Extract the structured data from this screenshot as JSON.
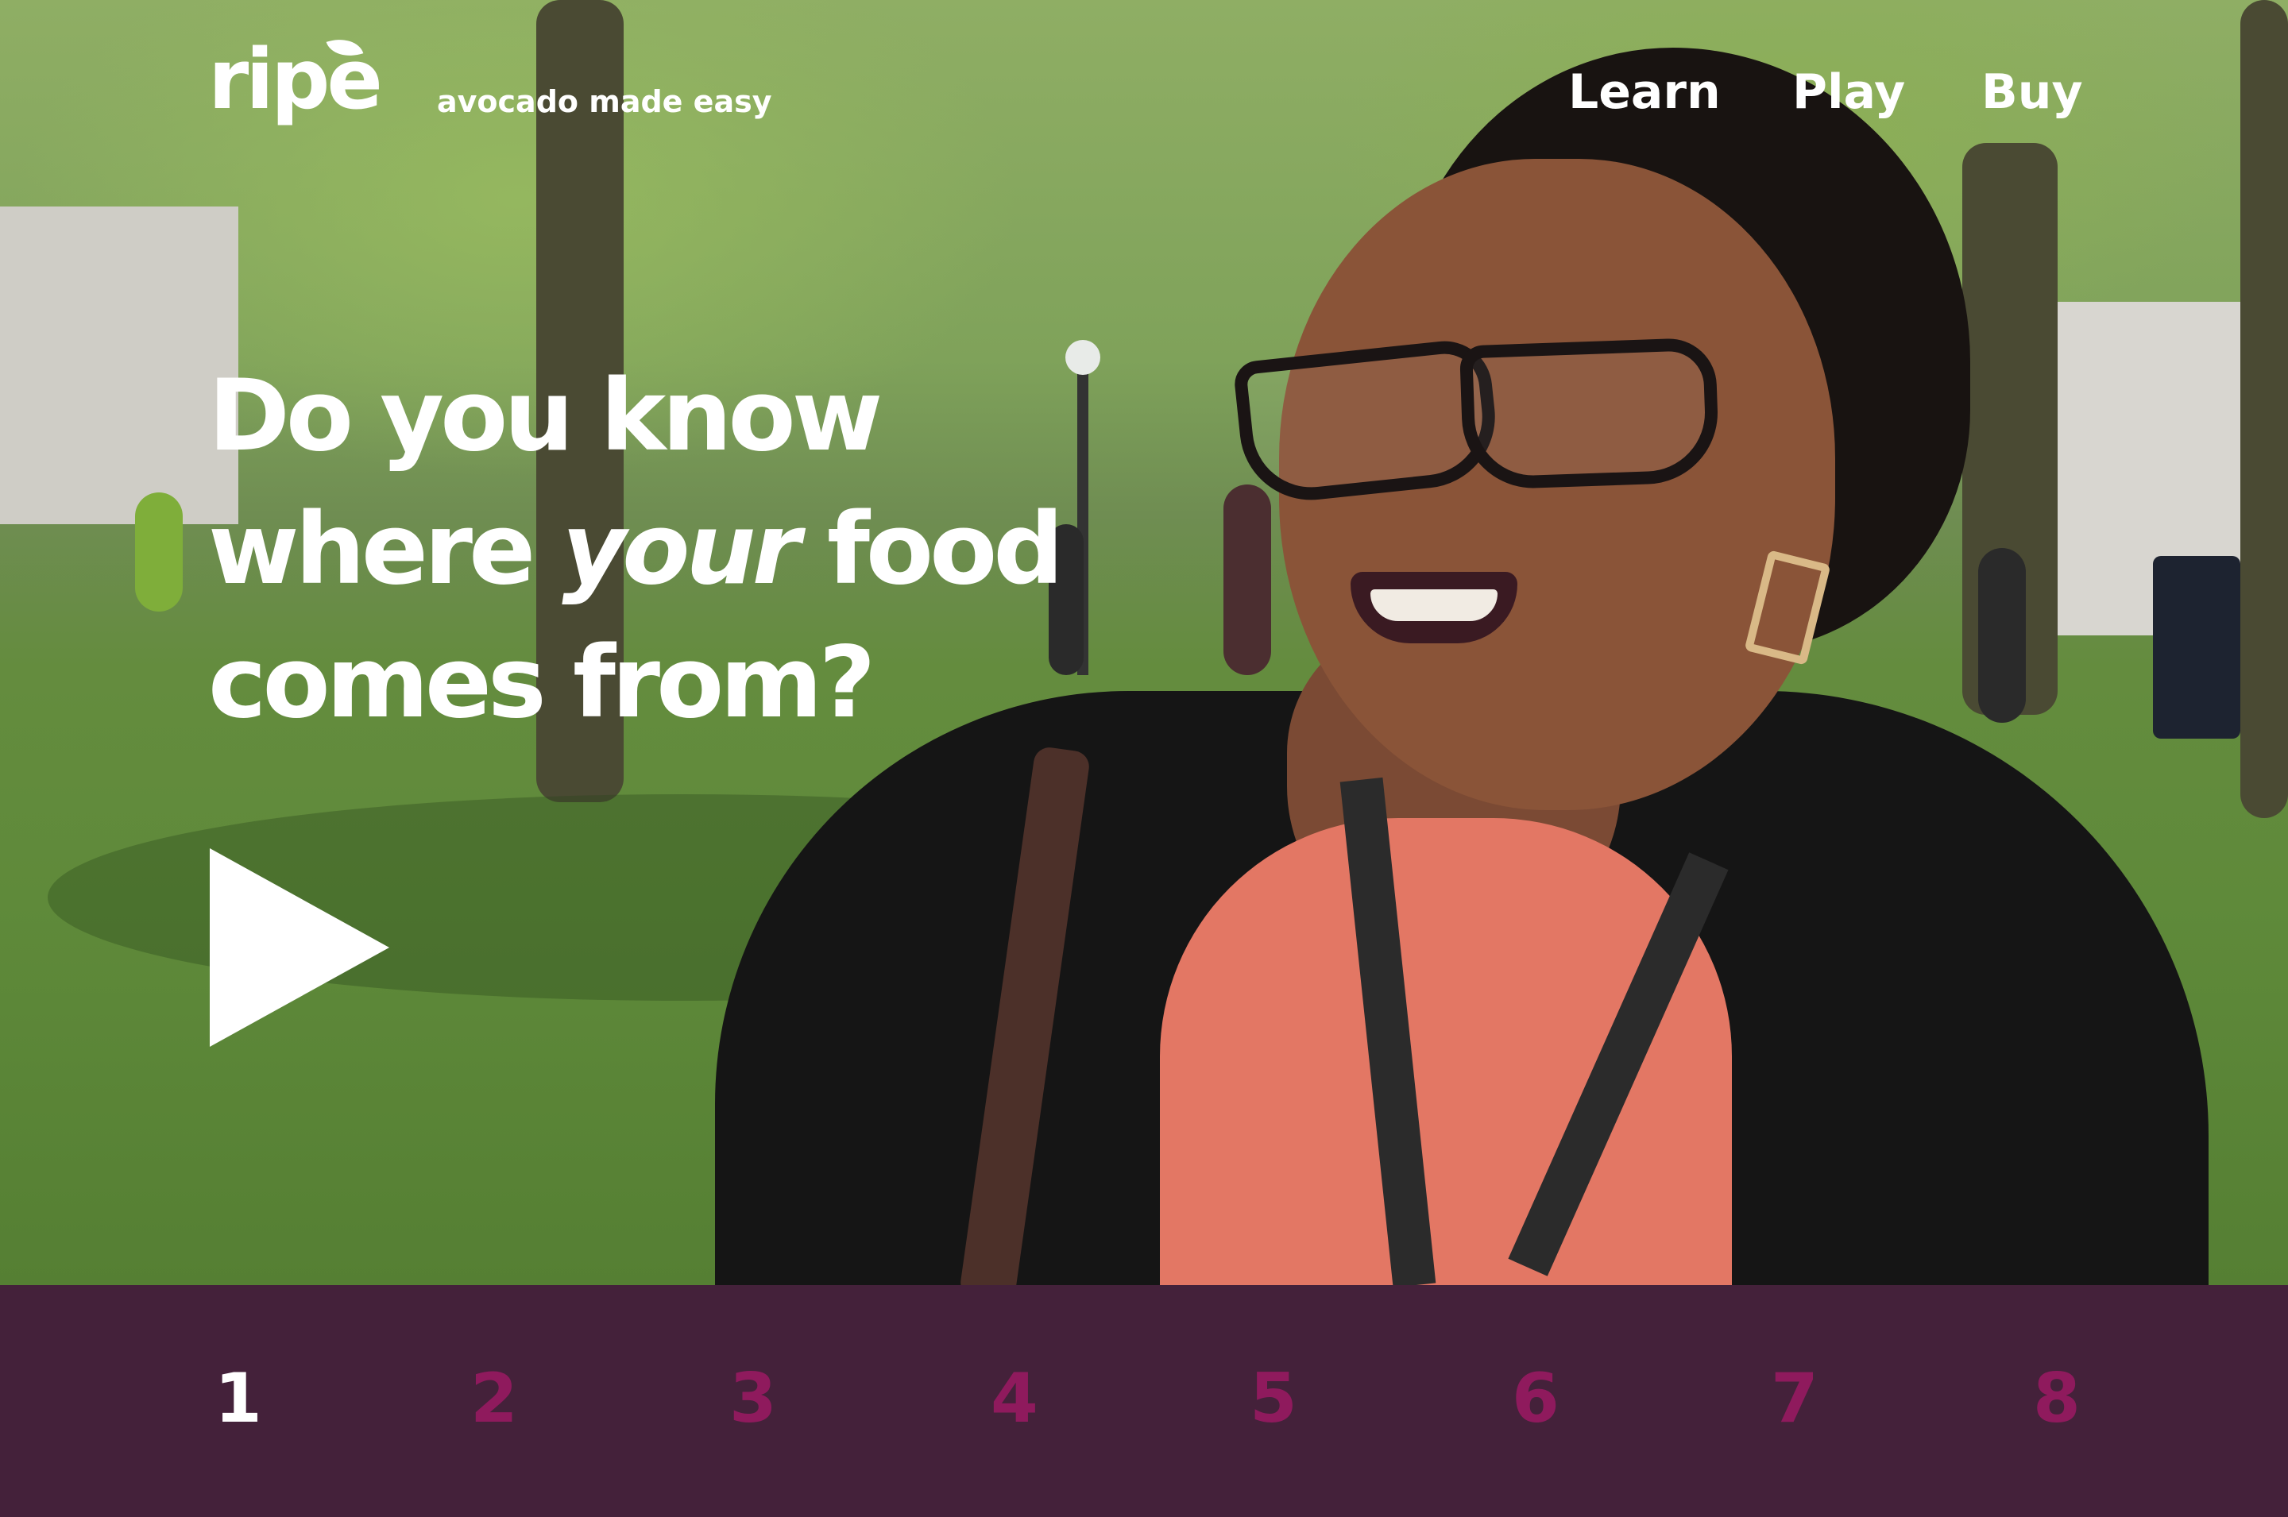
{
  "brand": {
    "logo_text": "ripe",
    "tagline": "avocado made easy"
  },
  "nav": {
    "learn": "Learn",
    "play": "Play",
    "buy": "Buy"
  },
  "hero": {
    "headline_line1": "Do you know",
    "headline_where": "where ",
    "headline_your": "your",
    "headline_food": " food",
    "headline_line3": "comes from?",
    "play_icon": "play-icon"
  },
  "chapters": {
    "items": [
      "1",
      "2",
      "3",
      "4",
      "5",
      "6",
      "7",
      "8"
    ],
    "active_index": 0
  },
  "colors": {
    "strip_background": "#44213a",
    "chapter_inactive": "#8f1a5d",
    "chapter_active": "#ffffff"
  }
}
